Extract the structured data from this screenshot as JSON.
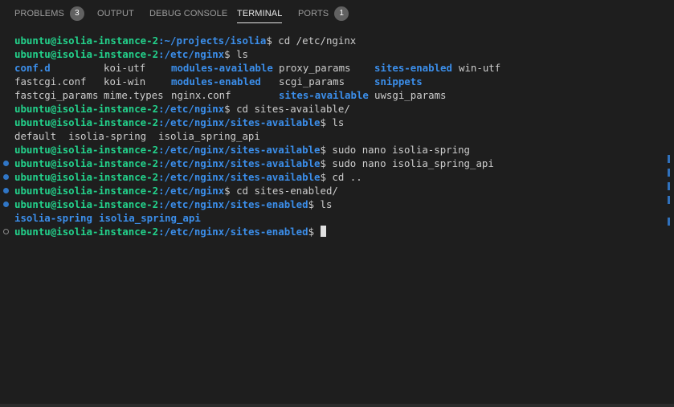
{
  "tabs": [
    {
      "label": "PROBLEMS",
      "badge": "3"
    },
    {
      "label": "OUTPUT"
    },
    {
      "label": "DEBUG CONSOLE"
    },
    {
      "label": "TERMINAL",
      "active": true
    },
    {
      "label": "PORTS",
      "badge": "1"
    }
  ],
  "prompt": {
    "user": "ubuntu",
    "at": "@",
    "host": "isolia-instance-2",
    "sep": ":",
    "dollar": "$"
  },
  "lines": [
    {
      "path": "~/projects/isolia",
      "cmd": " cd /etc/nginx"
    },
    {
      "path": "/etc/nginx",
      "cmd": " ls"
    },
    {
      "ls": [
        "conf.d",
        "koi-utf",
        "modules-available",
        "proxy_params",
        "sites-enabled",
        "win-utf"
      ]
    },
    {
      "ls": [
        "fastcgi.conf",
        "koi-win",
        "modules-enabled",
        "scgi_params",
        "snippets",
        ""
      ]
    },
    {
      "ls": [
        "fastcgi_params",
        "mime.types",
        "nginx.conf",
        "sites-available",
        "uwsgi_params",
        ""
      ]
    },
    {
      "path": "/etc/nginx",
      "cmd": " cd sites-available/"
    },
    {
      "path": "/etc/nginx/sites-available",
      "cmd": " ls"
    },
    {
      "text": "default  isolia-spring  isolia_spring_api"
    },
    {
      "path": "/etc/nginx/sites-available",
      "cmd": " sudo nano isolia-spring"
    },
    {
      "path": "/etc/nginx/sites-available",
      "cmd": " sudo nano isolia_spring_api"
    },
    {
      "path": "/etc/nginx/sites-available",
      "cmd": " cd .."
    },
    {
      "path": "/etc/nginx",
      "cmd": " cd sites-enabled/"
    },
    {
      "path": "/etc/nginx/sites-enabled",
      "cmd": " ls"
    },
    {
      "ls2": [
        "isolia-spring",
        "isolia_spring_api"
      ]
    },
    {
      "path": "/etc/nginx/sites-enabled",
      "cmd": " "
    }
  ]
}
